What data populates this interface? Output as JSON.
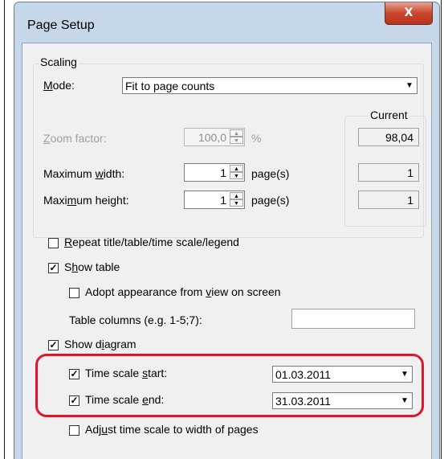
{
  "window": {
    "title": "Page Setup",
    "close_label": "X"
  },
  "scaling": {
    "group_label": "Scaling",
    "mode_label": "Mode:",
    "mode_value": "Fit to page counts",
    "zoom_label": "Zoom factor:",
    "zoom_value": "100,0",
    "zoom_unit": "%",
    "max_width_label": "Maximum width:",
    "max_width_value": "1",
    "max_width_unit": "page(s)",
    "max_height_label": "Maximum height:",
    "max_height_value": "1",
    "max_height_unit": "page(s)",
    "current_label": "Current",
    "current_zoom": "98,04",
    "current_width": "1",
    "current_height": "1"
  },
  "options": {
    "repeat_title_label": "Repeat title/table/time scale/legend",
    "repeat_title_checked": false,
    "show_table_label": "Show table",
    "show_table_checked": true,
    "adopt_appearance_label": "Adopt appearance from view on screen",
    "adopt_appearance_checked": false,
    "table_columns_label": "Table columns (e.g. 1-5;7):",
    "table_columns_value": "",
    "show_diagram_label": "Show diagram",
    "show_diagram_checked": true,
    "time_scale_start_label": "Time scale start:",
    "time_scale_start_checked": true,
    "time_scale_start_value": "01.03.2011",
    "time_scale_end_label": "Time scale end:",
    "time_scale_end_checked": true,
    "time_scale_end_value": "31.03.2011",
    "adjust_time_scale_label": "Adjust time scale to width of pages",
    "adjust_time_scale_checked": false
  },
  "colors": {
    "highlight": "#e0152f",
    "titlebar": "#c6d7ea",
    "close_button": "#c8462c"
  }
}
